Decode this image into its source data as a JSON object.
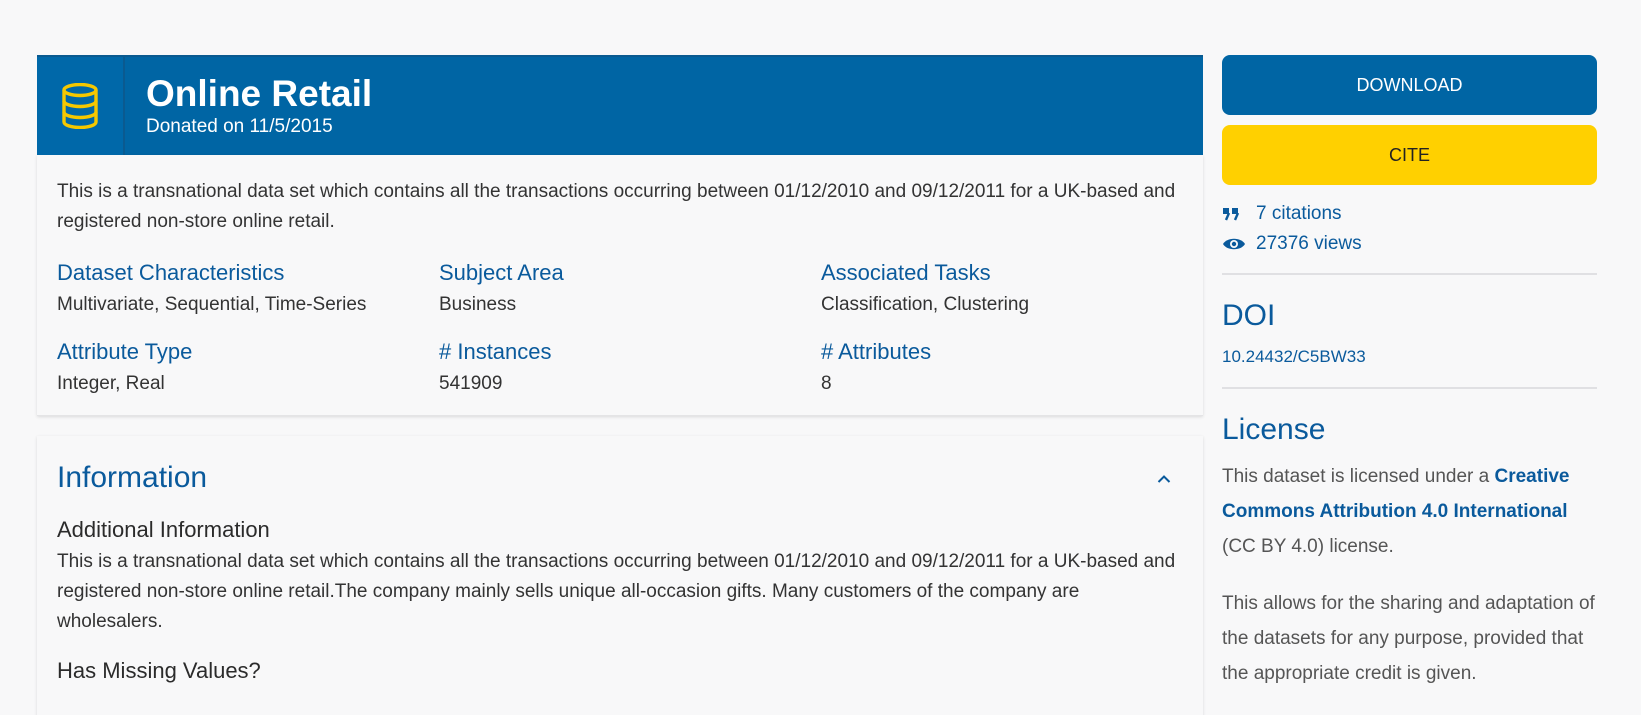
{
  "dataset": {
    "title": "Online Retail",
    "donated": "Donated on 11/5/2015",
    "summary": "This is a transnational data set which contains all the transactions occurring between 01/12/2010 and 09/12/2011 for a UK-based and registered non-store online retail.",
    "icon": "database-icon"
  },
  "characteristics": [
    {
      "label": "Dataset Characteristics",
      "value": "Multivariate, Sequential, Time-Series"
    },
    {
      "label": "Subject Area",
      "value": "Business"
    },
    {
      "label": "Associated Tasks",
      "value": "Classification, Clustering"
    },
    {
      "label": "Attribute Type",
      "value": "Integer, Real"
    },
    {
      "label": "# Instances",
      "value": "541909"
    },
    {
      "label": "# Attributes",
      "value": "8"
    }
  ],
  "information": {
    "title": "Information",
    "additional_heading": "Additional Information",
    "additional_text": "This is a transnational data set which contains all the transactions occurring between 01/12/2010 and 09/12/2011 for a UK-based and registered non-store online retail.The company mainly sells unique all-occasion gifts. Many customers of the company are wholesalers.",
    "missing_heading": "Has Missing Values?"
  },
  "sidebar": {
    "download_label": "DOWNLOAD",
    "cite_label": "CITE",
    "citations": "7 citations",
    "views": "27376 views",
    "doi_title": "DOI",
    "doi_value": "10.24432/C5BW33",
    "license_title": "License",
    "license_prefix": "This dataset is licensed under a ",
    "license_link": "Creative Commons Attribution 4.0 International",
    "license_suffix": " (CC BY 4.0) license.",
    "license_note": "This allows for the sharing and adaptation of the datasets for any purpose, provided that the appropriate credit is given."
  },
  "colors": {
    "primary": "#0065a4",
    "accent": "#ffd000",
    "link": "#0a5a9c"
  }
}
